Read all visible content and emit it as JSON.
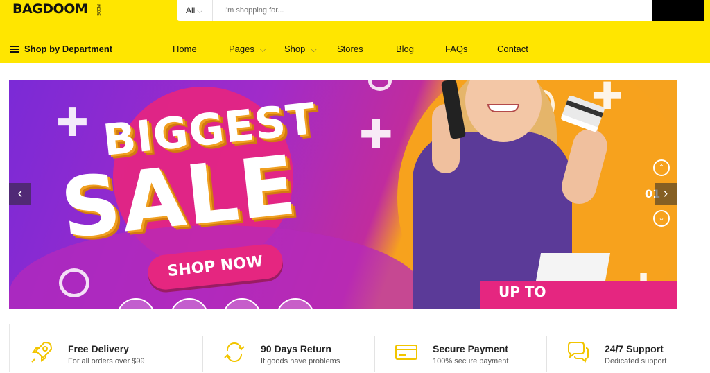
{
  "header": {
    "logo": "BAGDOOM",
    "logo_sub": "MODE",
    "search": {
      "category": "All",
      "placeholder": "I'm shopping for..."
    }
  },
  "nav": {
    "department": "Shop by Department",
    "items": [
      "Home",
      "Pages",
      "Shop",
      "Stores",
      "Blog",
      "FAQs",
      "Contact"
    ]
  },
  "banner": {
    "line1": "BIGGEST",
    "line2": "SALE",
    "cta": "SHOP NOW",
    "promo": "UP TO",
    "slide_number": "01",
    "colors": {
      "purple": "#7b2ad6",
      "pink": "#e52680",
      "orange": "#f7a21d"
    }
  },
  "features": [
    {
      "title": "Free Delivery",
      "subtitle": "For all orders over $99",
      "icon": "rocket-icon"
    },
    {
      "title": "90 Days Return",
      "subtitle": "If goods have problems",
      "icon": "return-icon"
    },
    {
      "title": "Secure Payment",
      "subtitle": "100% secure payment",
      "icon": "credit-card-icon"
    },
    {
      "title": "24/7 Support",
      "subtitle": "Dedicated support",
      "icon": "chat-icon"
    }
  ],
  "colors": {
    "accent": "#ffe600",
    "icon": "#f2c500"
  }
}
